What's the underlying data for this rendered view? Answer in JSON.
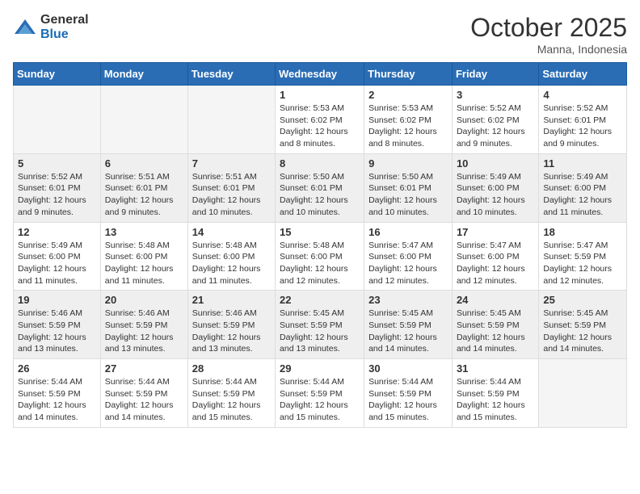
{
  "header": {
    "logo_general": "General",
    "logo_blue": "Blue",
    "month": "October 2025",
    "location": "Manna, Indonesia"
  },
  "weekdays": [
    "Sunday",
    "Monday",
    "Tuesday",
    "Wednesday",
    "Thursday",
    "Friday",
    "Saturday"
  ],
  "weeks": [
    [
      {
        "day": "",
        "sunrise": "",
        "sunset": "",
        "daylight": ""
      },
      {
        "day": "",
        "sunrise": "",
        "sunset": "",
        "daylight": ""
      },
      {
        "day": "",
        "sunrise": "",
        "sunset": "",
        "daylight": ""
      },
      {
        "day": "1",
        "sunrise": "Sunrise: 5:53 AM",
        "sunset": "Sunset: 6:02 PM",
        "daylight": "Daylight: 12 hours and 8 minutes."
      },
      {
        "day": "2",
        "sunrise": "Sunrise: 5:53 AM",
        "sunset": "Sunset: 6:02 PM",
        "daylight": "Daylight: 12 hours and 8 minutes."
      },
      {
        "day": "3",
        "sunrise": "Sunrise: 5:52 AM",
        "sunset": "Sunset: 6:02 PM",
        "daylight": "Daylight: 12 hours and 9 minutes."
      },
      {
        "day": "4",
        "sunrise": "Sunrise: 5:52 AM",
        "sunset": "Sunset: 6:01 PM",
        "daylight": "Daylight: 12 hours and 9 minutes."
      }
    ],
    [
      {
        "day": "5",
        "sunrise": "Sunrise: 5:52 AM",
        "sunset": "Sunset: 6:01 PM",
        "daylight": "Daylight: 12 hours and 9 minutes."
      },
      {
        "day": "6",
        "sunrise": "Sunrise: 5:51 AM",
        "sunset": "Sunset: 6:01 PM",
        "daylight": "Daylight: 12 hours and 9 minutes."
      },
      {
        "day": "7",
        "sunrise": "Sunrise: 5:51 AM",
        "sunset": "Sunset: 6:01 PM",
        "daylight": "Daylight: 12 hours and 10 minutes."
      },
      {
        "day": "8",
        "sunrise": "Sunrise: 5:50 AM",
        "sunset": "Sunset: 6:01 PM",
        "daylight": "Daylight: 12 hours and 10 minutes."
      },
      {
        "day": "9",
        "sunrise": "Sunrise: 5:50 AM",
        "sunset": "Sunset: 6:01 PM",
        "daylight": "Daylight: 12 hours and 10 minutes."
      },
      {
        "day": "10",
        "sunrise": "Sunrise: 5:49 AM",
        "sunset": "Sunset: 6:00 PM",
        "daylight": "Daylight: 12 hours and 10 minutes."
      },
      {
        "day": "11",
        "sunrise": "Sunrise: 5:49 AM",
        "sunset": "Sunset: 6:00 PM",
        "daylight": "Daylight: 12 hours and 11 minutes."
      }
    ],
    [
      {
        "day": "12",
        "sunrise": "Sunrise: 5:49 AM",
        "sunset": "Sunset: 6:00 PM",
        "daylight": "Daylight: 12 hours and 11 minutes."
      },
      {
        "day": "13",
        "sunrise": "Sunrise: 5:48 AM",
        "sunset": "Sunset: 6:00 PM",
        "daylight": "Daylight: 12 hours and 11 minutes."
      },
      {
        "day": "14",
        "sunrise": "Sunrise: 5:48 AM",
        "sunset": "Sunset: 6:00 PM",
        "daylight": "Daylight: 12 hours and 11 minutes."
      },
      {
        "day": "15",
        "sunrise": "Sunrise: 5:48 AM",
        "sunset": "Sunset: 6:00 PM",
        "daylight": "Daylight: 12 hours and 12 minutes."
      },
      {
        "day": "16",
        "sunrise": "Sunrise: 5:47 AM",
        "sunset": "Sunset: 6:00 PM",
        "daylight": "Daylight: 12 hours and 12 minutes."
      },
      {
        "day": "17",
        "sunrise": "Sunrise: 5:47 AM",
        "sunset": "Sunset: 6:00 PM",
        "daylight": "Daylight: 12 hours and 12 minutes."
      },
      {
        "day": "18",
        "sunrise": "Sunrise: 5:47 AM",
        "sunset": "Sunset: 5:59 PM",
        "daylight": "Daylight: 12 hours and 12 minutes."
      }
    ],
    [
      {
        "day": "19",
        "sunrise": "Sunrise: 5:46 AM",
        "sunset": "Sunset: 5:59 PM",
        "daylight": "Daylight: 12 hours and 13 minutes."
      },
      {
        "day": "20",
        "sunrise": "Sunrise: 5:46 AM",
        "sunset": "Sunset: 5:59 PM",
        "daylight": "Daylight: 12 hours and 13 minutes."
      },
      {
        "day": "21",
        "sunrise": "Sunrise: 5:46 AM",
        "sunset": "Sunset: 5:59 PM",
        "daylight": "Daylight: 12 hours and 13 minutes."
      },
      {
        "day": "22",
        "sunrise": "Sunrise: 5:45 AM",
        "sunset": "Sunset: 5:59 PM",
        "daylight": "Daylight: 12 hours and 13 minutes."
      },
      {
        "day": "23",
        "sunrise": "Sunrise: 5:45 AM",
        "sunset": "Sunset: 5:59 PM",
        "daylight": "Daylight: 12 hours and 14 minutes."
      },
      {
        "day": "24",
        "sunrise": "Sunrise: 5:45 AM",
        "sunset": "Sunset: 5:59 PM",
        "daylight": "Daylight: 12 hours and 14 minutes."
      },
      {
        "day": "25",
        "sunrise": "Sunrise: 5:45 AM",
        "sunset": "Sunset: 5:59 PM",
        "daylight": "Daylight: 12 hours and 14 minutes."
      }
    ],
    [
      {
        "day": "26",
        "sunrise": "Sunrise: 5:44 AM",
        "sunset": "Sunset: 5:59 PM",
        "daylight": "Daylight: 12 hours and 14 minutes."
      },
      {
        "day": "27",
        "sunrise": "Sunrise: 5:44 AM",
        "sunset": "Sunset: 5:59 PM",
        "daylight": "Daylight: 12 hours and 14 minutes."
      },
      {
        "day": "28",
        "sunrise": "Sunrise: 5:44 AM",
        "sunset": "Sunset: 5:59 PM",
        "daylight": "Daylight: 12 hours and 15 minutes."
      },
      {
        "day": "29",
        "sunrise": "Sunrise: 5:44 AM",
        "sunset": "Sunset: 5:59 PM",
        "daylight": "Daylight: 12 hours and 15 minutes."
      },
      {
        "day": "30",
        "sunrise": "Sunrise: 5:44 AM",
        "sunset": "Sunset: 5:59 PM",
        "daylight": "Daylight: 12 hours and 15 minutes."
      },
      {
        "day": "31",
        "sunrise": "Sunrise: 5:44 AM",
        "sunset": "Sunset: 5:59 PM",
        "daylight": "Daylight: 12 hours and 15 minutes."
      },
      {
        "day": "",
        "sunrise": "",
        "sunset": "",
        "daylight": ""
      }
    ]
  ]
}
